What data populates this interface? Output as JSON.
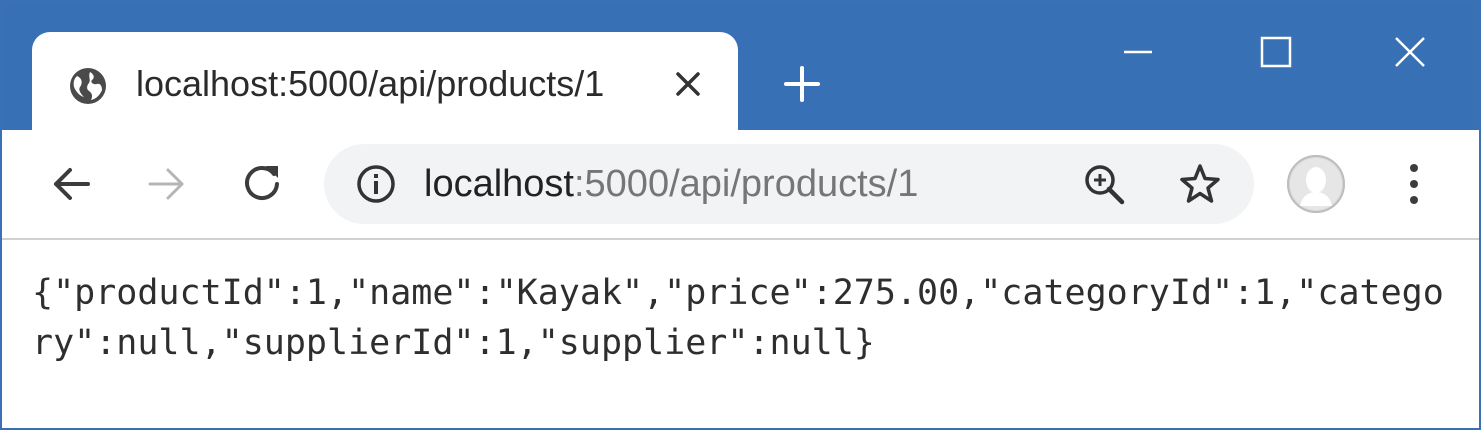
{
  "browser": {
    "tab": {
      "title": "localhost:5000/api/products/1",
      "favicon": "globe-icon"
    },
    "controls": {
      "new_tab": "plus-icon",
      "minimize": "minimize-icon",
      "maximize": "maximize-icon",
      "close": "close-icon"
    },
    "toolbar": {
      "back": "arrow-left-icon",
      "forward": "arrow-right-icon",
      "reload": "reload-icon",
      "site_info": "info-icon",
      "zoom": "zoom-in-icon",
      "bookmark": "star-icon",
      "profile": "avatar-icon",
      "menu": "kebab-menu-icon"
    },
    "address": {
      "host": "localhost",
      "rest": ":5000/api/products/1"
    }
  },
  "page": {
    "body_text": "{\"productId\":1,\"name\":\"Kayak\",\"price\":275.00,\"categoryId\":1,\"category\":null,\"supplierId\":1,\"supplier\":null}"
  },
  "colors": {
    "titlebar": "#3870b6",
    "omnibox": "#f1f3f4",
    "text": "#2e2e2e",
    "url_secondary": "#767676"
  }
}
